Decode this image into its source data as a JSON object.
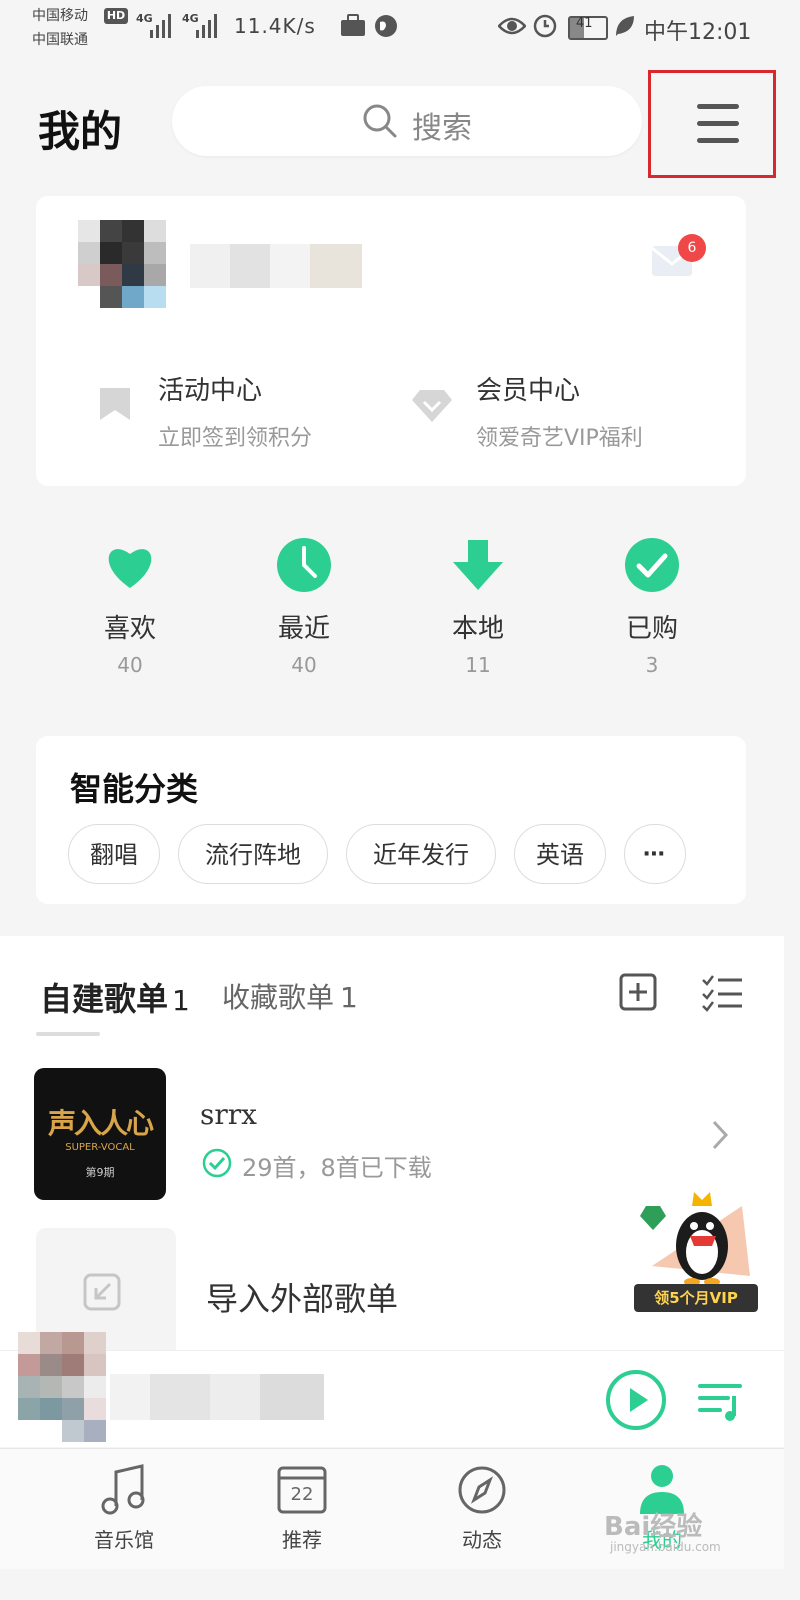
{
  "status_bar": {
    "carrier_1": "中国移动",
    "hd_badge": "HD",
    "carrier_2": "中国联通",
    "network_1": "4G",
    "network_2": "4G",
    "speed": "11.4K/s",
    "battery": "41",
    "time": "中午12:01"
  },
  "header": {
    "title": "我的",
    "search_placeholder": "搜索"
  },
  "profile": {
    "mail_badge": "6",
    "activity": {
      "title": "活动中心",
      "subtitle": "立即签到领积分"
    },
    "vip": {
      "title": "会员中心",
      "subtitle": "领爱奇艺VIP福利"
    }
  },
  "stats": [
    {
      "label": "喜欢",
      "count": "40",
      "icon": "heart-icon"
    },
    {
      "label": "最近",
      "count": "40",
      "icon": "clock-icon"
    },
    {
      "label": "本地",
      "count": "11",
      "icon": "download-icon"
    },
    {
      "label": "已购",
      "count": "3",
      "icon": "check-circle-icon"
    }
  ],
  "smart_category": {
    "title": "智能分类",
    "chips": [
      "翻唱",
      "流行阵地",
      "近年发行",
      "英语"
    ]
  },
  "playlists": {
    "tab_own": "自建歌单",
    "tab_own_count": "1",
    "tab_fav": "收藏歌单",
    "tab_fav_count": "1",
    "items": [
      {
        "name": "srrx",
        "meta": "29首，8首已下载",
        "cover_text": "声入人心",
        "cover_sub": "SUPER-VOCAL",
        "cover_issue": "第9期"
      }
    ],
    "import_label": "导入外部歌单"
  },
  "vip_promo": {
    "label": "领5个月VIP"
  },
  "bottom_nav": [
    {
      "label": "音乐馆",
      "icon": "music-note-icon"
    },
    {
      "label": "推荐",
      "icon": "calendar-icon",
      "icon_text": "22"
    },
    {
      "label": "动态",
      "icon": "compass-icon"
    },
    {
      "label": "我的",
      "icon": "profile-icon"
    }
  ],
  "watermark": {
    "text": "Bai经验",
    "sub": "jingyan.baidu.com"
  },
  "colors": {
    "accent": "#2dce92",
    "annotation": "#d9272e"
  }
}
